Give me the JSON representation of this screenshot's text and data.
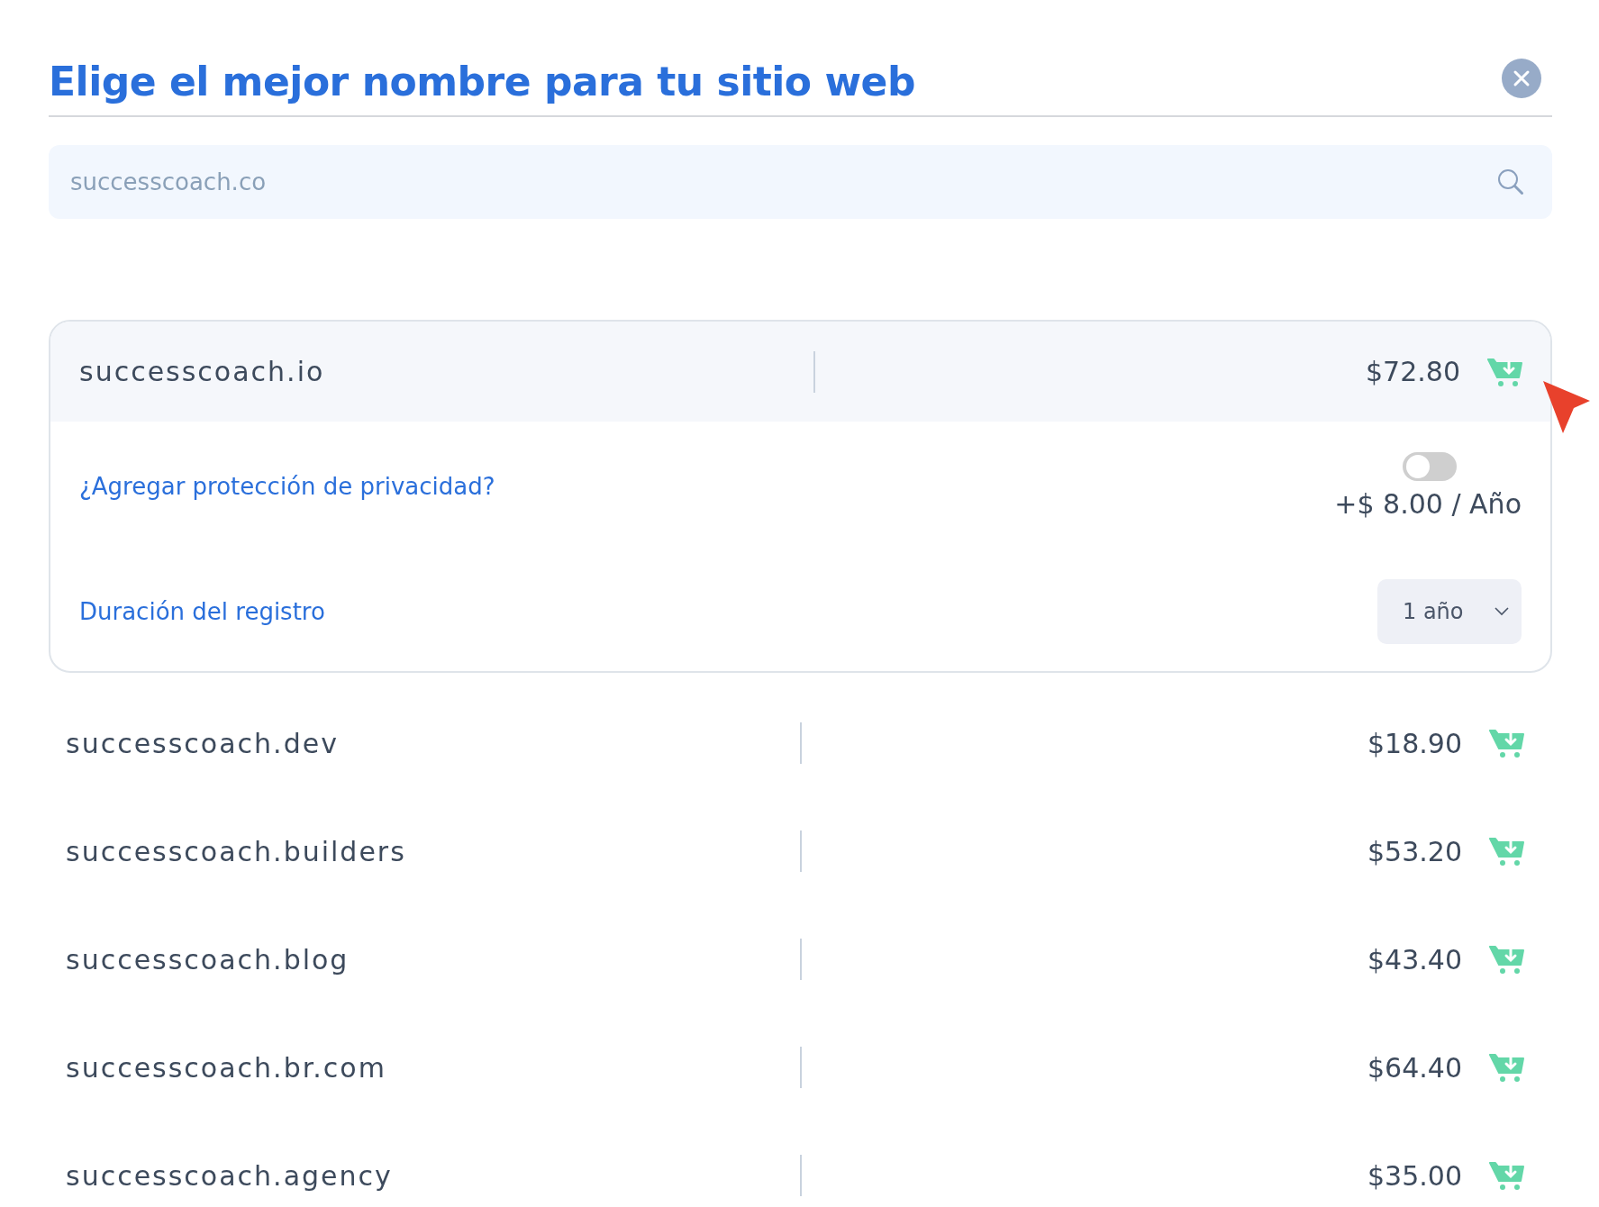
{
  "title": "Elige el mejor nombre para tu sitio web",
  "search": {
    "value": "successcoach.co"
  },
  "selected_domain": {
    "name": "successcoach.io",
    "price": "$72.80",
    "privacy": {
      "label": "¿Agregar protección de privacidad?",
      "on": false,
      "price": "+$ 8.00 / Año"
    },
    "duration": {
      "label": "Duración del registro",
      "value": "1 año"
    }
  },
  "domains": [
    {
      "name": "successcoach.dev",
      "price": "$18.90"
    },
    {
      "name": "successcoach.builders",
      "price": "$53.20"
    },
    {
      "name": "successcoach.blog",
      "price": "$43.40"
    },
    {
      "name": "successcoach.br.com",
      "price": "$64.40"
    },
    {
      "name": "successcoach.agency",
      "price": "$35.00"
    }
  ]
}
